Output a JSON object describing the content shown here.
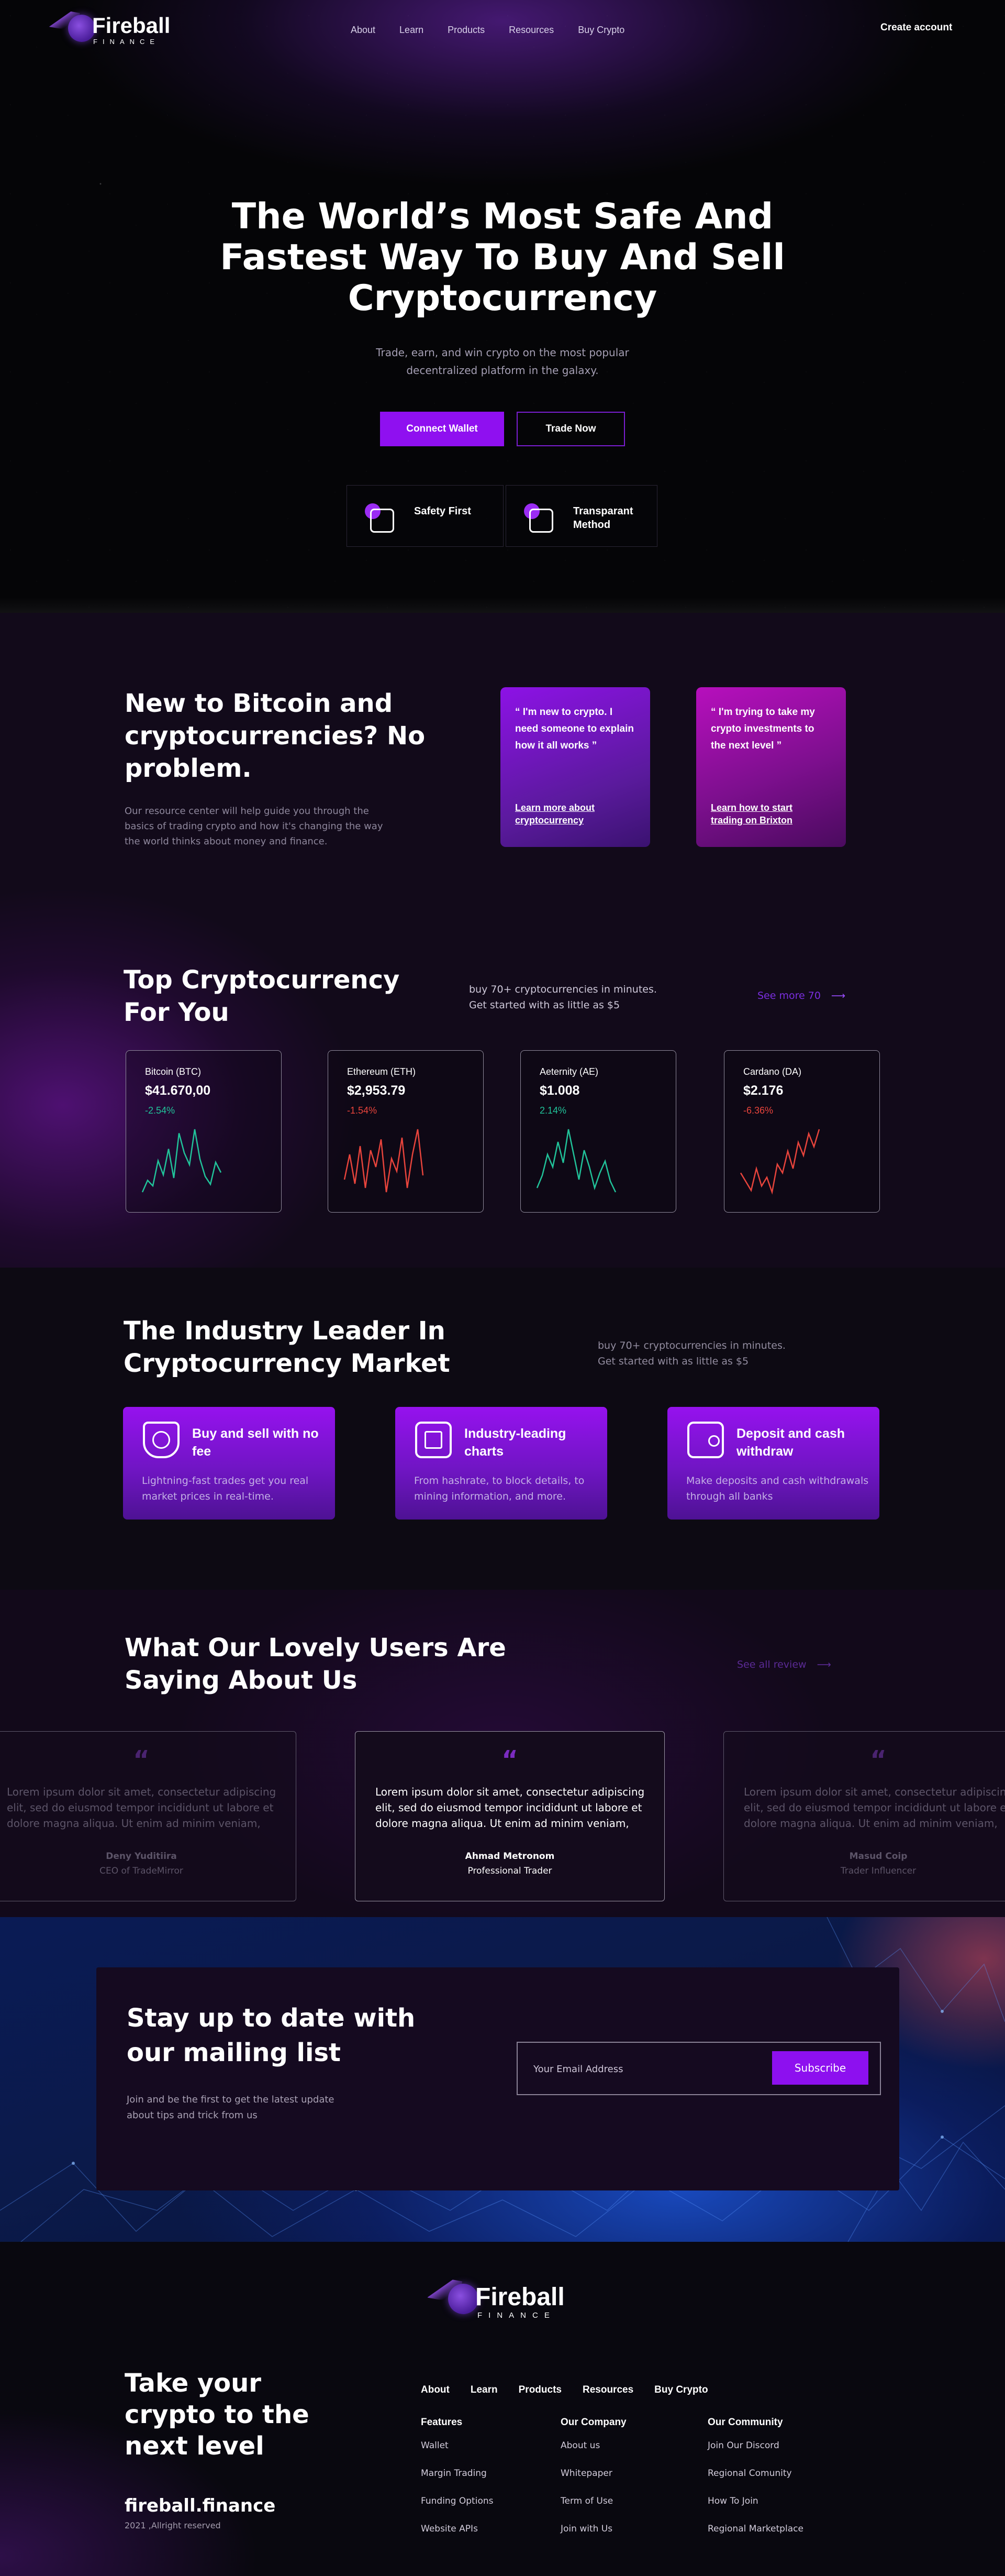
{
  "brand": {
    "name": "Fireball",
    "tagline": "FINANCE"
  },
  "nav": {
    "links": [
      "About",
      "Learn",
      "Products",
      "Resources",
      "Buy Crypto"
    ],
    "cta": "Create account"
  },
  "hero": {
    "title_lines": [
      "The World’s Most Safe And",
      "Fastest Way To Buy And Sell",
      "Cryptocurrency"
    ],
    "subtitle_lines": [
      "Trade, earn, and win crypto on the most popular",
      "decentralized platform in the galaxy."
    ],
    "primary_button": "Connect Wallet",
    "secondary_button": "Trade Now",
    "features": [
      "Safety First",
      "Transparant Method"
    ]
  },
  "intro": {
    "title": "New to Bitcoin and cryptocurrencies? No problem.",
    "text": "Our resource center will help guide you through the basics of trading crypto and how it's changing the way the world thinks about money and finance.",
    "cards": [
      {
        "quote": "“ I'm new to crypto. I need someone to explain how it all works ”",
        "link": "Learn more about cryptocurrency"
      },
      {
        "quote": "“ I'm trying to take my crypto investments to the next level ”",
        "link": "Learn how to start trading on Brixton"
      }
    ]
  },
  "top_crypto": {
    "title": "Top Cryptocurrency For You",
    "sub_lines": [
      "buy 70+ cryptocurrencies in minutes.",
      "Get started with as little as $5"
    ],
    "see_more": "See more 70",
    "coins": [
      {
        "name": "Bitcoin (BTC)",
        "price": "$41.670,00",
        "change": "-2.54%",
        "color": "#21c39a",
        "trend": [
          20,
          35,
          28,
          60,
          42,
          75,
          38,
          95,
          70,
          55,
          100,
          62,
          40,
          30,
          58,
          45
        ]
      },
      {
        "name": "Ethereum (ETH)",
        "price": "$2,953.79",
        "change": "-1.54%",
        "color": "#e8443c",
        "trend": [
          40,
          70,
          35,
          80,
          30,
          75,
          55,
          88,
          25,
          65,
          50,
          90,
          30,
          70,
          100,
          45
        ]
      },
      {
        "name": "Aeternity (AE)",
        "price": "$1.008",
        "change": "2.14%",
        "color": "#21c39a",
        "trend": [
          30,
          45,
          70,
          55,
          85,
          60,
          100,
          70,
          40,
          75,
          55,
          30,
          48,
          62,
          38,
          25
        ]
      },
      {
        "name": "Cardano (DA)",
        "price": "$2.176",
        "change": "-6.36%",
        "color": "#e8443c",
        "trend": [
          50,
          40,
          30,
          55,
          35,
          45,
          28,
          60,
          50,
          75,
          55,
          85,
          70,
          95,
          80,
          100
        ]
      }
    ]
  },
  "industry": {
    "title": "The Industry Leader In Cryptocurrency Market",
    "sub_lines": [
      "buy 70+ cryptocurrencies in minutes.",
      "Get started with as little as $5"
    ],
    "cards": [
      {
        "title": "Buy and sell with no fee",
        "text": "Lightning-fast trades get you real market prices in real-time."
      },
      {
        "title": "Industry-leading charts",
        "text": "From hashrate, to block details, to mining information, and more."
      },
      {
        "title": "Deposit and cash withdraw",
        "text": "Make deposits and cash withdrawals through all banks"
      }
    ]
  },
  "testimonials": {
    "title": "What Our Lovely Users Are Saying About Us",
    "see_all": "See all review",
    "items": [
      {
        "text": "Lorem ipsum dolor sit amet, consectetur adipiscing elit, sed do eiusmod tempor incididunt ut labore et dolore magna aliqua. Ut enim ad minim veniam,",
        "name": "Deny Yuditiira",
        "role": "CEO of TradeMirror"
      },
      {
        "text": "Lorem ipsum dolor sit amet, consectetur adipiscing elit, sed do eiusmod tempor incididunt ut labore et dolore magna aliqua. Ut enim ad minim veniam,",
        "name": "Ahmad Metronom",
        "role": "Professional Trader"
      },
      {
        "text": "Lorem ipsum dolor sit amet, consectetur adipiscing elit, sed do eiusmod tempor incididunt ut labore et dolore magna aliqua. Ut enim ad minim veniam,",
        "name": "Masud Coip",
        "role": "Trader Influencer"
      }
    ]
  },
  "newsletter": {
    "title": "Stay up to date with our mailing list",
    "text": "Join and be the first to get the latest update about tips and trick from us",
    "placeholder": "Your Email Address",
    "button": "Subscribe"
  },
  "footer": {
    "tagline": "Take your crypto to the next level",
    "domain": "fireball.finance",
    "copyright": "2021 ,Allright reserved",
    "nav": [
      "About",
      "Learn",
      "Products",
      "Resources",
      "Buy Crypto"
    ],
    "columns": [
      {
        "title": "Features",
        "items": [
          "Wallet",
          "Margin Trading",
          "Funding Options",
          "Website APIs"
        ]
      },
      {
        "title": "Our Company",
        "items": [
          "About us",
          "Whitepaper",
          "Term of Use",
          "Join with Us"
        ]
      },
      {
        "title": "Our Community",
        "items": [
          "Join Our Discord",
          "Regional Comunity",
          "How To Join",
          "Regional Marketplace"
        ]
      }
    ]
  },
  "colors": {
    "accent": "#8f10f0",
    "positive": "#21c39a",
    "negative": "#e8443c"
  }
}
